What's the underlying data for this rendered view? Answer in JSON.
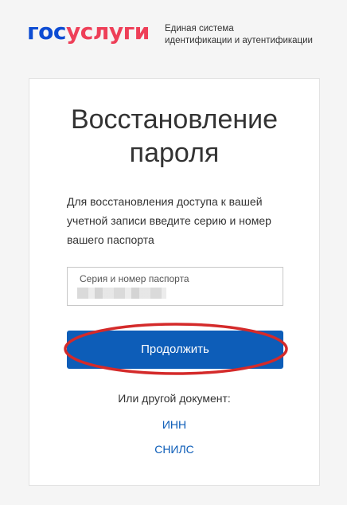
{
  "header": {
    "logo_part1": "гос",
    "logo_part2": "услуги",
    "tagline_line1": "Единая система",
    "tagline_line2": "идентификации и аутентификации"
  },
  "card": {
    "title_line1": "Восстановление",
    "title_line2": "пароля",
    "description": "Для восстановления доступа к вашей учетной записи введите серию и номер вашего паспорта",
    "passport_field": {
      "label": "Серия и номер паспорта",
      "value_state": "blurred"
    },
    "continue_button": "Продолжить",
    "alternative_label": "Или другой документ:",
    "links": {
      "inn": "ИНН",
      "snils": "СНИЛС"
    }
  },
  "colors": {
    "brand_blue": "#0d4cd3",
    "brand_red": "#ee3f58",
    "button_blue": "#0d5db8",
    "highlight_red": "#d42a2a",
    "background": "#f5f5f5"
  }
}
